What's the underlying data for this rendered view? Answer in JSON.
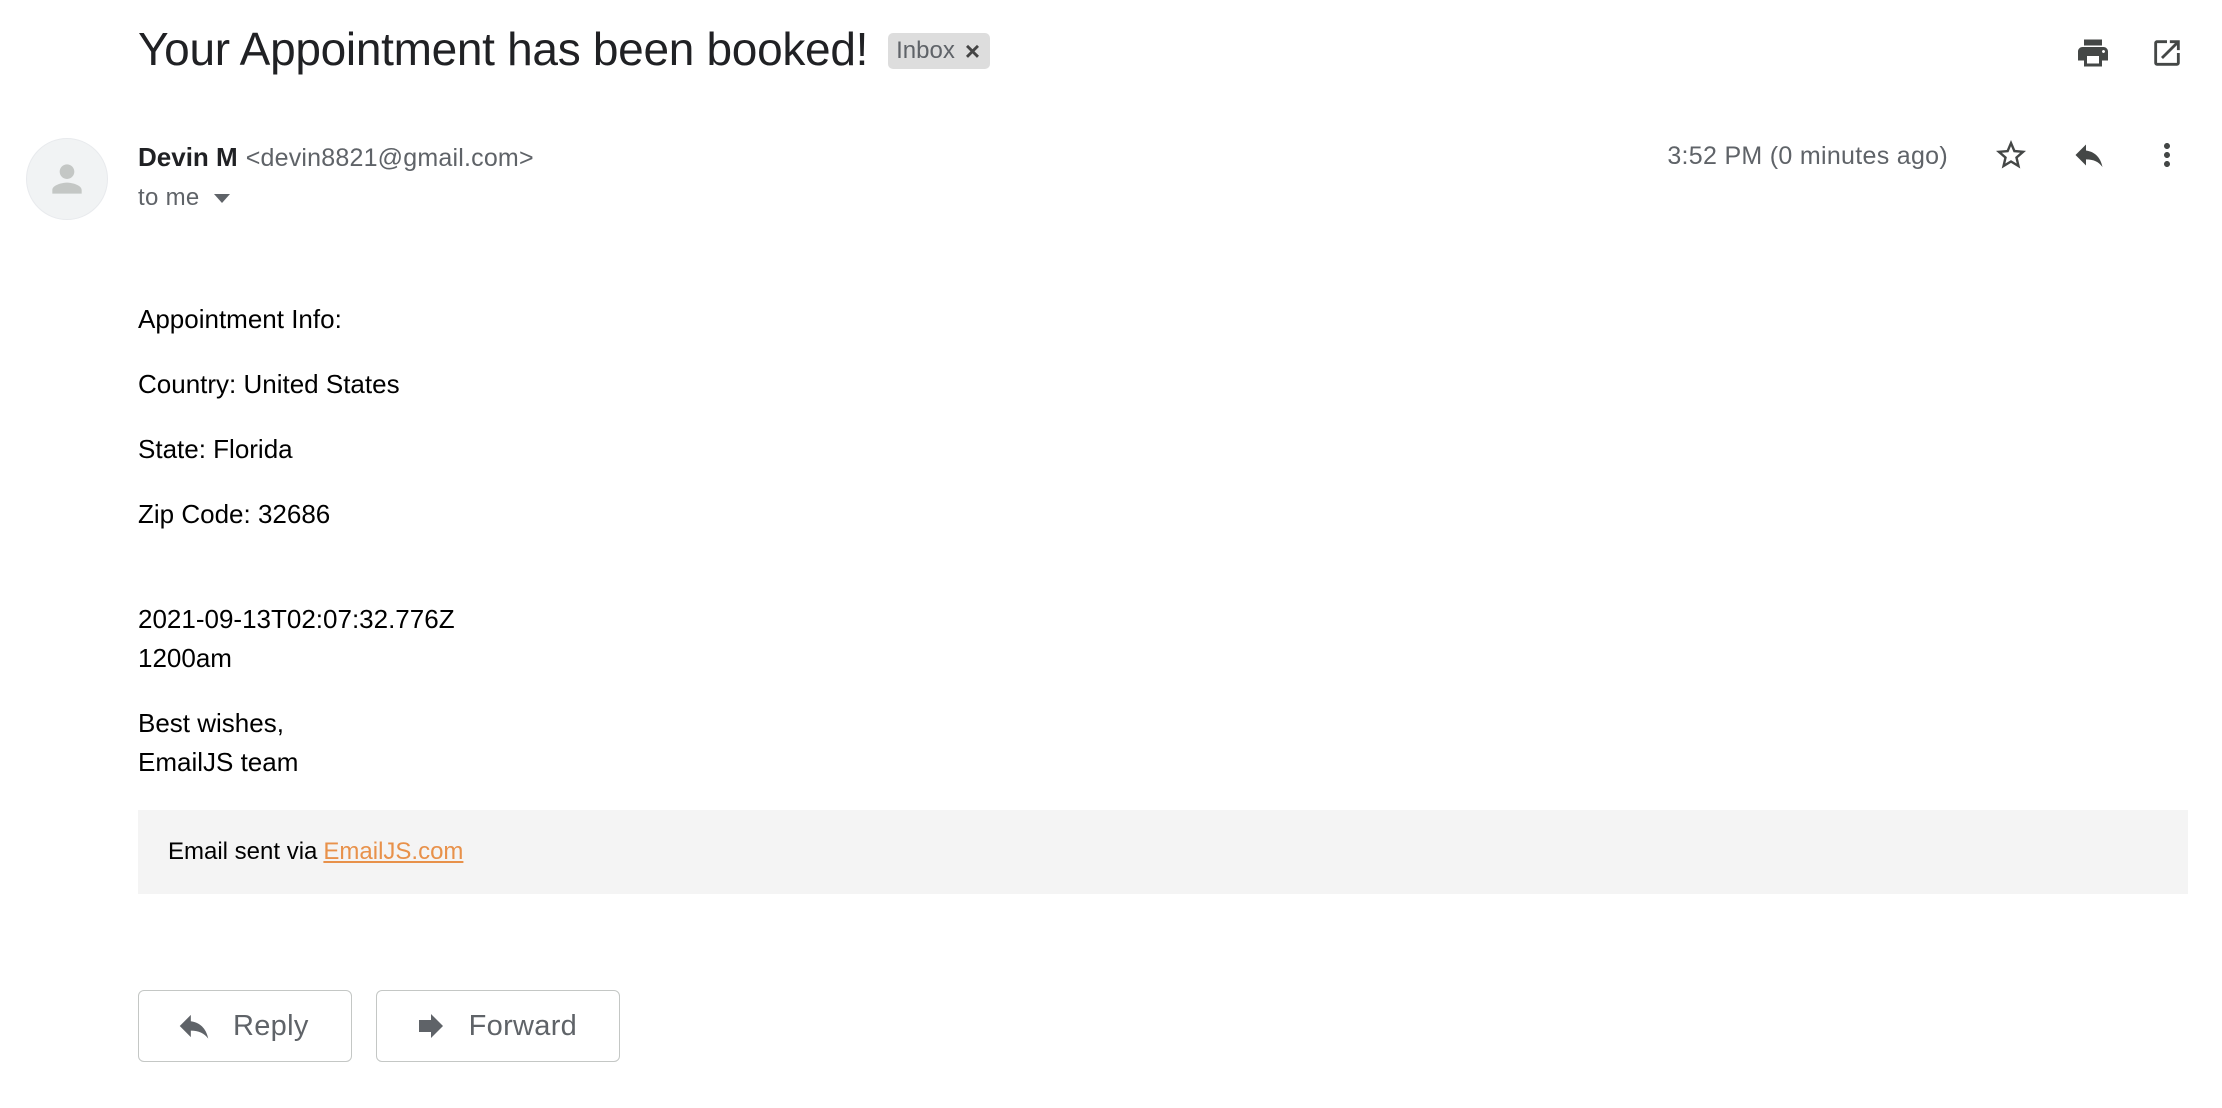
{
  "subject": "Your Appointment has been booked!",
  "label": {
    "text": "Inbox",
    "remove": "×"
  },
  "top_actions": {
    "print_icon": "printer-icon",
    "popout_icon": "open-in-new-window-icon"
  },
  "sender": {
    "name": "Devin M",
    "email": "<devin8821@gmail.com>",
    "recipient": "to me",
    "avatar_icon": "person-icon"
  },
  "timestamp": "3:52 PM (0 minutes ago)",
  "message_actions": {
    "star_icon": "star-icon",
    "reply_icon": "reply-icon",
    "more_icon": "more-vertical-icon"
  },
  "body": {
    "heading": "Appointment Info:",
    "country": "Country: United States",
    "state": "State: Florida",
    "zip": "Zip Code: 32686",
    "datetime": "2021-09-13T02:07:32.776Z",
    "time": "1200am",
    "closing": "Best wishes,",
    "signature": "EmailJS team"
  },
  "footer": {
    "text": "Email sent via",
    "link": "EmailJS.com",
    "link_color": "#e8914a"
  },
  "buttons": {
    "reply": "Reply",
    "forward": "Forward"
  }
}
